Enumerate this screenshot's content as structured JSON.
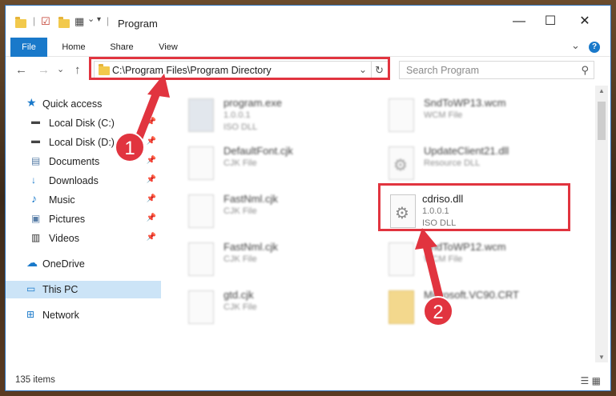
{
  "window": {
    "title": "Program",
    "minimize": "—",
    "maximize": "☐",
    "close": "✕"
  },
  "ribbon": {
    "tabs": [
      "File",
      "Home",
      "Share",
      "View"
    ],
    "expand": "⌄",
    "help": "?"
  },
  "nav": {
    "back": "←",
    "forward": "→",
    "recent": "⌄",
    "up": "↑",
    "address": "C:\\Program Files\\Program Directory",
    "address_dropdown": "⌄",
    "refresh": "↻",
    "search_placeholder": "Search Program"
  },
  "sidebar": {
    "items": [
      {
        "label": "Quick access",
        "icon": "star-icon",
        "pinned": false
      },
      {
        "label": "Local Disk (C:)",
        "icon": "drive-icon",
        "pinned": true
      },
      {
        "label": "Local Disk (D:)",
        "icon": "drive-icon",
        "pinned": true
      },
      {
        "label": "Documents",
        "icon": "documents-icon",
        "pinned": true
      },
      {
        "label": "Downloads",
        "icon": "downloads-icon",
        "pinned": true
      },
      {
        "label": "Music",
        "icon": "music-icon",
        "pinned": true
      },
      {
        "label": "Pictures",
        "icon": "pictures-icon",
        "pinned": true
      },
      {
        "label": "Videos",
        "icon": "videos-icon",
        "pinned": true
      },
      {
        "label": "OneDrive",
        "icon": "cloud-icon",
        "pinned": false
      },
      {
        "label": "This PC",
        "icon": "computer-icon",
        "pinned": false,
        "selected": true
      },
      {
        "label": "Network",
        "icon": "network-icon",
        "pinned": false
      }
    ]
  },
  "files": [
    {
      "name": "program.exe",
      "line2": "1.0.0.1",
      "line3": "ISO DLL"
    },
    {
      "name": "SndToWP13.wcm",
      "line2": "WCM File",
      "line3": ""
    },
    {
      "name": "DefaultFont.cjk",
      "line2": "CJK File",
      "line3": ""
    },
    {
      "name": "UpdateClient21.dll",
      "line2": "Resource DLL",
      "line3": ""
    },
    {
      "name": "FastNml.cjk",
      "line2": "CJK File",
      "line3": ""
    },
    {
      "name": "cdriso.dll",
      "line2": "1.0.0.1",
      "line3": "ISO DLL"
    },
    {
      "name": "FastNml.cjk",
      "line2": "CJK File",
      "line3": ""
    },
    {
      "name": "SndToWP12.wcm",
      "line2": "WCM File",
      "line3": ""
    },
    {
      "name": "gtd.cjk",
      "line2": "CJK File",
      "line3": ""
    },
    {
      "name": "Microsoft.VC90.CRT",
      "line2": "",
      "line3": ""
    }
  ],
  "status": {
    "items": "135 items"
  },
  "callouts": [
    "1",
    "2"
  ],
  "colors": {
    "accent": "#1979ca",
    "highlight": "#e1343f",
    "selected": "#cce4f7"
  }
}
